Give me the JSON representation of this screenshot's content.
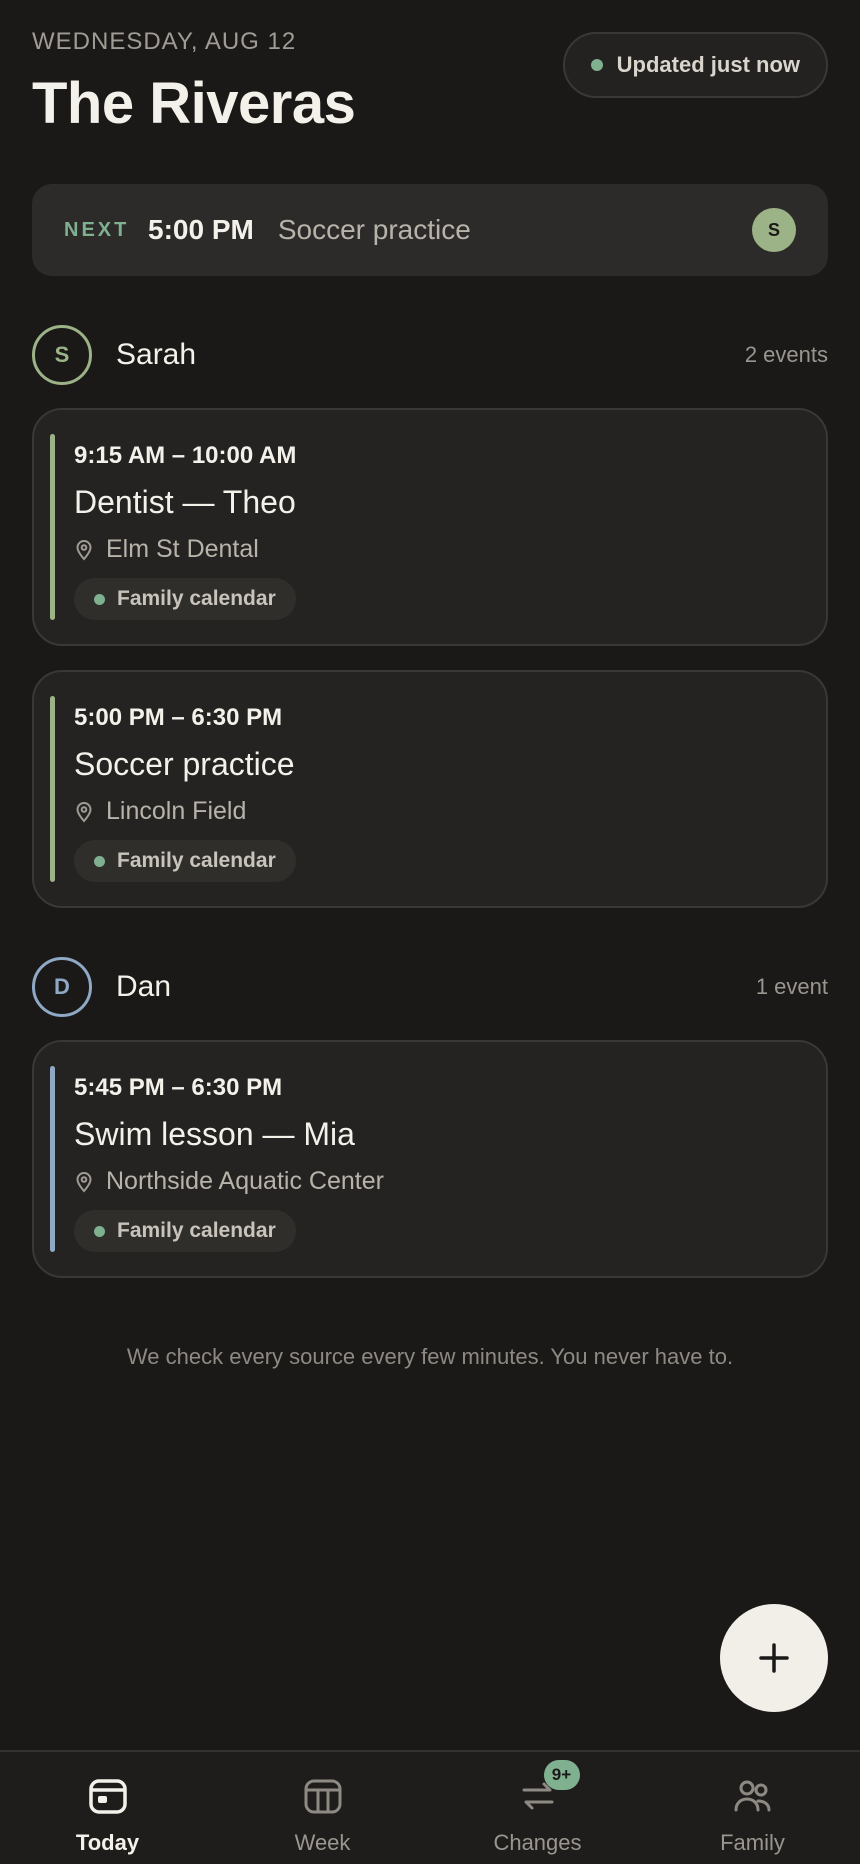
{
  "header": {
    "date": "WEDNESDAY, AUG 12",
    "title": "The Riveras",
    "status": "Updated just now"
  },
  "next": {
    "label": "NEXT",
    "time": "5:00 PM",
    "title": "Soccer practice",
    "avatar": "S"
  },
  "people": [
    {
      "initial": "S",
      "name": "Sarah",
      "count": "2 events",
      "color": "#9cb287",
      "events": [
        {
          "time": "9:15 AM – 10:00 AM",
          "title": "Dentist — Theo",
          "location": "Elm St Dental",
          "calendar": "Family calendar"
        },
        {
          "time": "5:00 PM – 6:30 PM",
          "title": "Soccer practice",
          "location": "Lincoln Field",
          "calendar": "Family calendar"
        }
      ]
    },
    {
      "initial": "D",
      "name": "Dan",
      "count": "1 event",
      "color": "#8fa8c4",
      "events": [
        {
          "time": "5:45 PM – 6:30 PM",
          "title": "Swim lesson — Mia",
          "location": "Northside Aquatic Center",
          "calendar": "Family calendar"
        }
      ]
    }
  ],
  "footnote": "We check every source every few minutes. You never have to.",
  "tabs": [
    {
      "label": "Today",
      "icon": "today-icon",
      "active": true
    },
    {
      "label": "Week",
      "icon": "week-icon",
      "active": false
    },
    {
      "label": "Changes",
      "icon": "changes-icon",
      "active": false,
      "badge": "9+"
    },
    {
      "label": "Family",
      "icon": "family-icon",
      "active": false
    }
  ],
  "colors": {
    "accent_green": "#7fb08f",
    "background": "#1a1918"
  }
}
